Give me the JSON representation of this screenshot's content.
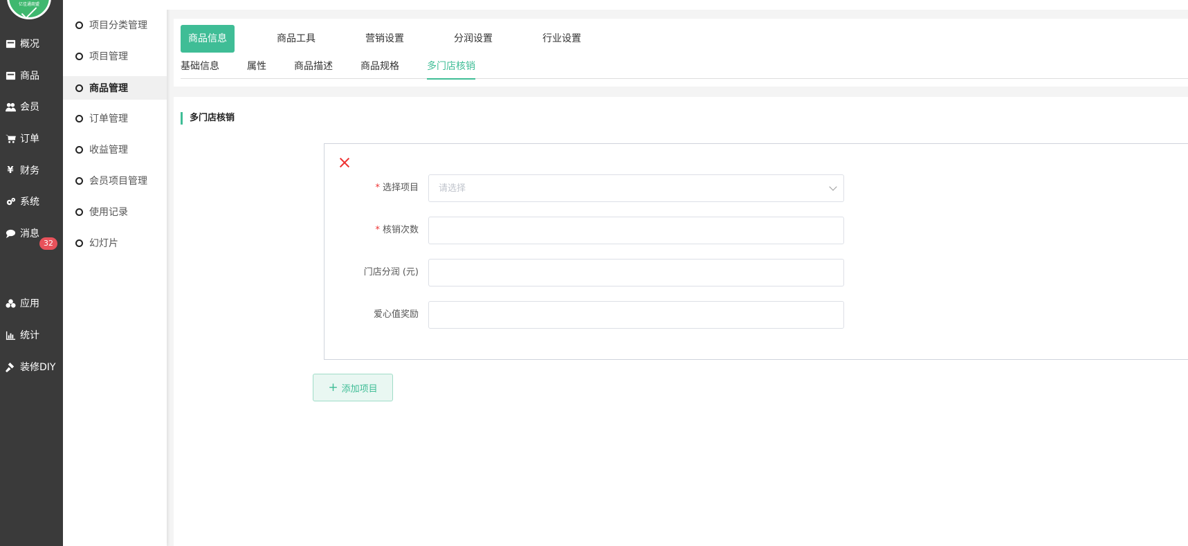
{
  "logo": {
    "text": "亿佳通商盟"
  },
  "nav": {
    "items": [
      {
        "label": "概况",
        "icon": "dashboard-icon"
      },
      {
        "label": "商品",
        "icon": "product-icon"
      },
      {
        "label": "会员",
        "icon": "users-icon"
      },
      {
        "label": "订单",
        "icon": "cart-icon"
      },
      {
        "label": "财务",
        "icon": "yen-icon"
      },
      {
        "label": "系统",
        "icon": "gears-icon"
      },
      {
        "label": "消息",
        "icon": "chat-icon",
        "badge": "32"
      },
      {
        "label": "应用",
        "icon": "apps-icon"
      },
      {
        "label": "统计",
        "icon": "bar-chart-icon"
      },
      {
        "label": "装修DIY",
        "icon": "hammer-icon"
      }
    ]
  },
  "submenu": {
    "items": [
      {
        "label": "项目分类管理"
      },
      {
        "label": "项目管理"
      },
      {
        "label": "商品管理",
        "active": true
      },
      {
        "label": "订单管理"
      },
      {
        "label": "收益管理"
      },
      {
        "label": "会员项目管理"
      },
      {
        "label": "使用记录"
      },
      {
        "label": "幻灯片"
      }
    ]
  },
  "tabs": {
    "main": [
      "商品信息",
      "商品工具",
      "营销设置",
      "分润设置",
      "行业设置"
    ],
    "active_main": "商品信息",
    "sub": [
      "基础信息",
      "属性",
      "商品描述",
      "商品规格",
      "多门店核销"
    ],
    "active_sub": "多门店核销"
  },
  "section": {
    "title": "多门店核销"
  },
  "form": {
    "select_project": {
      "label": "选择项目",
      "required_mark": "*",
      "placeholder": "请选择",
      "value": ""
    },
    "writeoff_count": {
      "label": "核销次数",
      "required_mark": "*",
      "value": ""
    },
    "store_share": {
      "label": "门店分润 (元)",
      "value": ""
    },
    "love_reward": {
      "label": "爱心值奖励",
      "value": ""
    }
  },
  "add_button": {
    "label": "添加项目"
  },
  "colors": {
    "accent": "#3fbd96",
    "nav_bg": "#3a3a3a",
    "badge": "#e8525b",
    "required": "#e33333"
  }
}
